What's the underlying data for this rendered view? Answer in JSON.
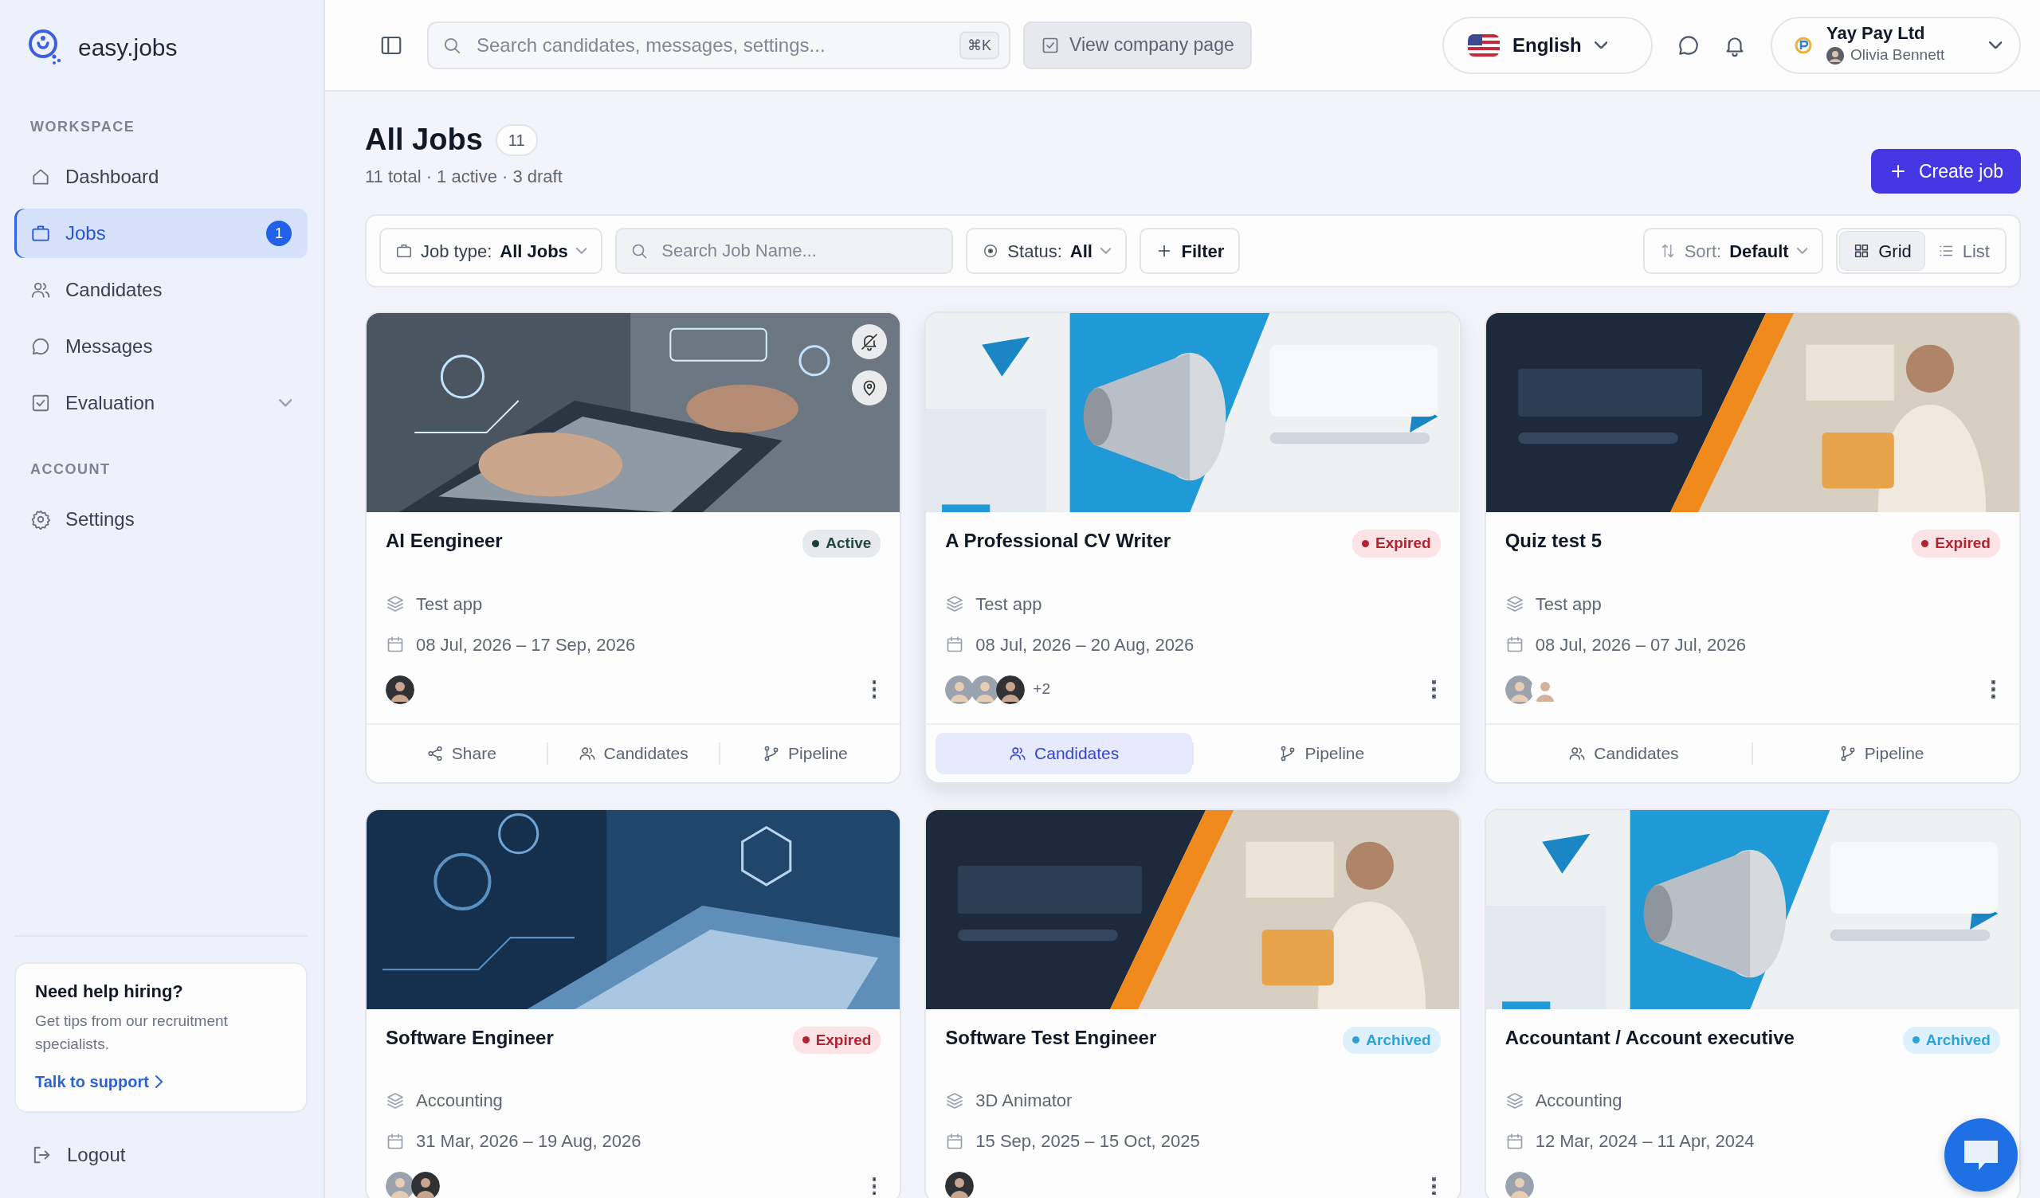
{
  "brand": {
    "name": "easy.jobs"
  },
  "sidebar": {
    "sections": [
      {
        "label": "WORKSPACE",
        "items": [
          {
            "label": "Dashboard",
            "selected": false
          },
          {
            "label": "Jobs",
            "selected": true,
            "badge": "1"
          },
          {
            "label": "Candidates",
            "selected": false
          },
          {
            "label": "Messages",
            "selected": false
          },
          {
            "label": "Evaluation",
            "selected": false,
            "expanded": false
          }
        ]
      },
      {
        "label": "ACCOUNT",
        "items": [
          {
            "label": "Settings",
            "selected": false
          }
        ]
      }
    ],
    "help_card": {
      "title": "Need help hiring?",
      "text": "Get tips from our recruitment specialists.",
      "link": "Talk to support"
    },
    "logout": "Logout"
  },
  "topbar": {
    "search": {
      "placeholder": "Search candidates, messages, settings...",
      "shortcut": "⌘K"
    },
    "company_page_button": "View company page",
    "language": "English",
    "account": {
      "company": "Yay Pay Ltd",
      "user": "Olivia Bennett"
    }
  },
  "header": {
    "title": "All Jobs",
    "count": "11",
    "summary": "11 total · 1 active · 3 draft",
    "create_button": "Create job"
  },
  "filters": {
    "job_type": {
      "label": "Job type:",
      "value": "All Jobs"
    },
    "search": {
      "placeholder": "Search Job Name..."
    },
    "status": {
      "label": "Status:",
      "value": "All"
    },
    "filter_button": "Filter",
    "sort": {
      "label": "Sort:",
      "value": "Default"
    },
    "views": [
      {
        "label": "Grid",
        "selected": true
      },
      {
        "label": "List",
        "selected": false
      }
    ]
  },
  "jobs": [
    {
      "kind": "picture",
      "title": "AI Eengineer",
      "status": {
        "kind": "active",
        "label": "Active"
      },
      "category": "Test app",
      "dates": "08 Jul, 2026 – 17 Sep, 2026",
      "overlay_icons": true,
      "more_button": true,
      "raised": false,
      "avatars": [
        {
          "kind": "dark"
        }
      ],
      "actions": [
        {
          "kind": "share",
          "label": "Share",
          "selected": false
        },
        {
          "kind": "candidates",
          "label": "Candidates",
          "selected": false
        },
        {
          "kind": "pipeline",
          "label": "Pipeline",
          "selected": false
        }
      ]
    },
    {
      "kind": "picture",
      "title": "A Professional CV Writer",
      "status": {
        "kind": "expired",
        "label": "Expired"
      },
      "category": "Test app",
      "dates": "08 Jul, 2026 – 20 Aug, 2026",
      "overlay_icons": false,
      "more_button": true,
      "raised": true,
      "avatars": [
        {
          "kind": "light"
        },
        {
          "kind": "light"
        },
        {
          "kind": "dark"
        }
      ],
      "more_avatars": "+2",
      "actions": [
        {
          "kind": "candidates",
          "label": "Candidates",
          "selected": true
        },
        {
          "kind": "pipeline",
          "label": "Pipeline",
          "selected": false
        }
      ]
    },
    {
      "kind": "picture",
      "title": "Quiz test 5",
      "status": {
        "kind": "expired",
        "label": "Expired"
      },
      "category": "Test app",
      "dates": "08 Jul, 2026 – 07 Jul, 2026",
      "overlay_icons": false,
      "more_button": true,
      "raised": false,
      "avatars": [
        {
          "kind": "light"
        },
        {
          "kind": "cutout"
        }
      ],
      "actions": [
        {
          "kind": "candidates",
          "label": "Candidates",
          "selected": false
        },
        {
          "kind": "pipeline",
          "label": "Pipeline",
          "selected": false
        }
      ]
    },
    {
      "kind": "picture",
      "title": "Software Engineer",
      "status": {
        "kind": "expired",
        "label": "Expired"
      },
      "category": "Accounting",
      "dates": "31 Mar, 2026 – 19 Aug, 2026",
      "overlay_icons": false,
      "more_button": true,
      "raised": false,
      "avatars": [
        {
          "kind": "light"
        },
        {
          "kind": "dark"
        }
      ]
    },
    {
      "kind": "picture",
      "title": "Software Test Engineer",
      "status": {
        "kind": "archived",
        "label": "Archived"
      },
      "category": "3D Animator",
      "dates": "15 Sep, 2025 – 15 Oct, 2025",
      "overlay_icons": false,
      "more_button": true,
      "raised": false,
      "avatars": [
        {
          "kind": "dark"
        }
      ]
    },
    {
      "kind": "picture",
      "title": "Accountant / Account executive",
      "status": {
        "kind": "archived",
        "label": "Archived"
      },
      "category": "Accounting",
      "dates": "12 Mar, 2024 – 11 Apr, 2024",
      "overlay_icons": false,
      "more_button": false,
      "raised": false,
      "avatars": [
        {
          "kind": "light"
        }
      ]
    }
  ]
}
